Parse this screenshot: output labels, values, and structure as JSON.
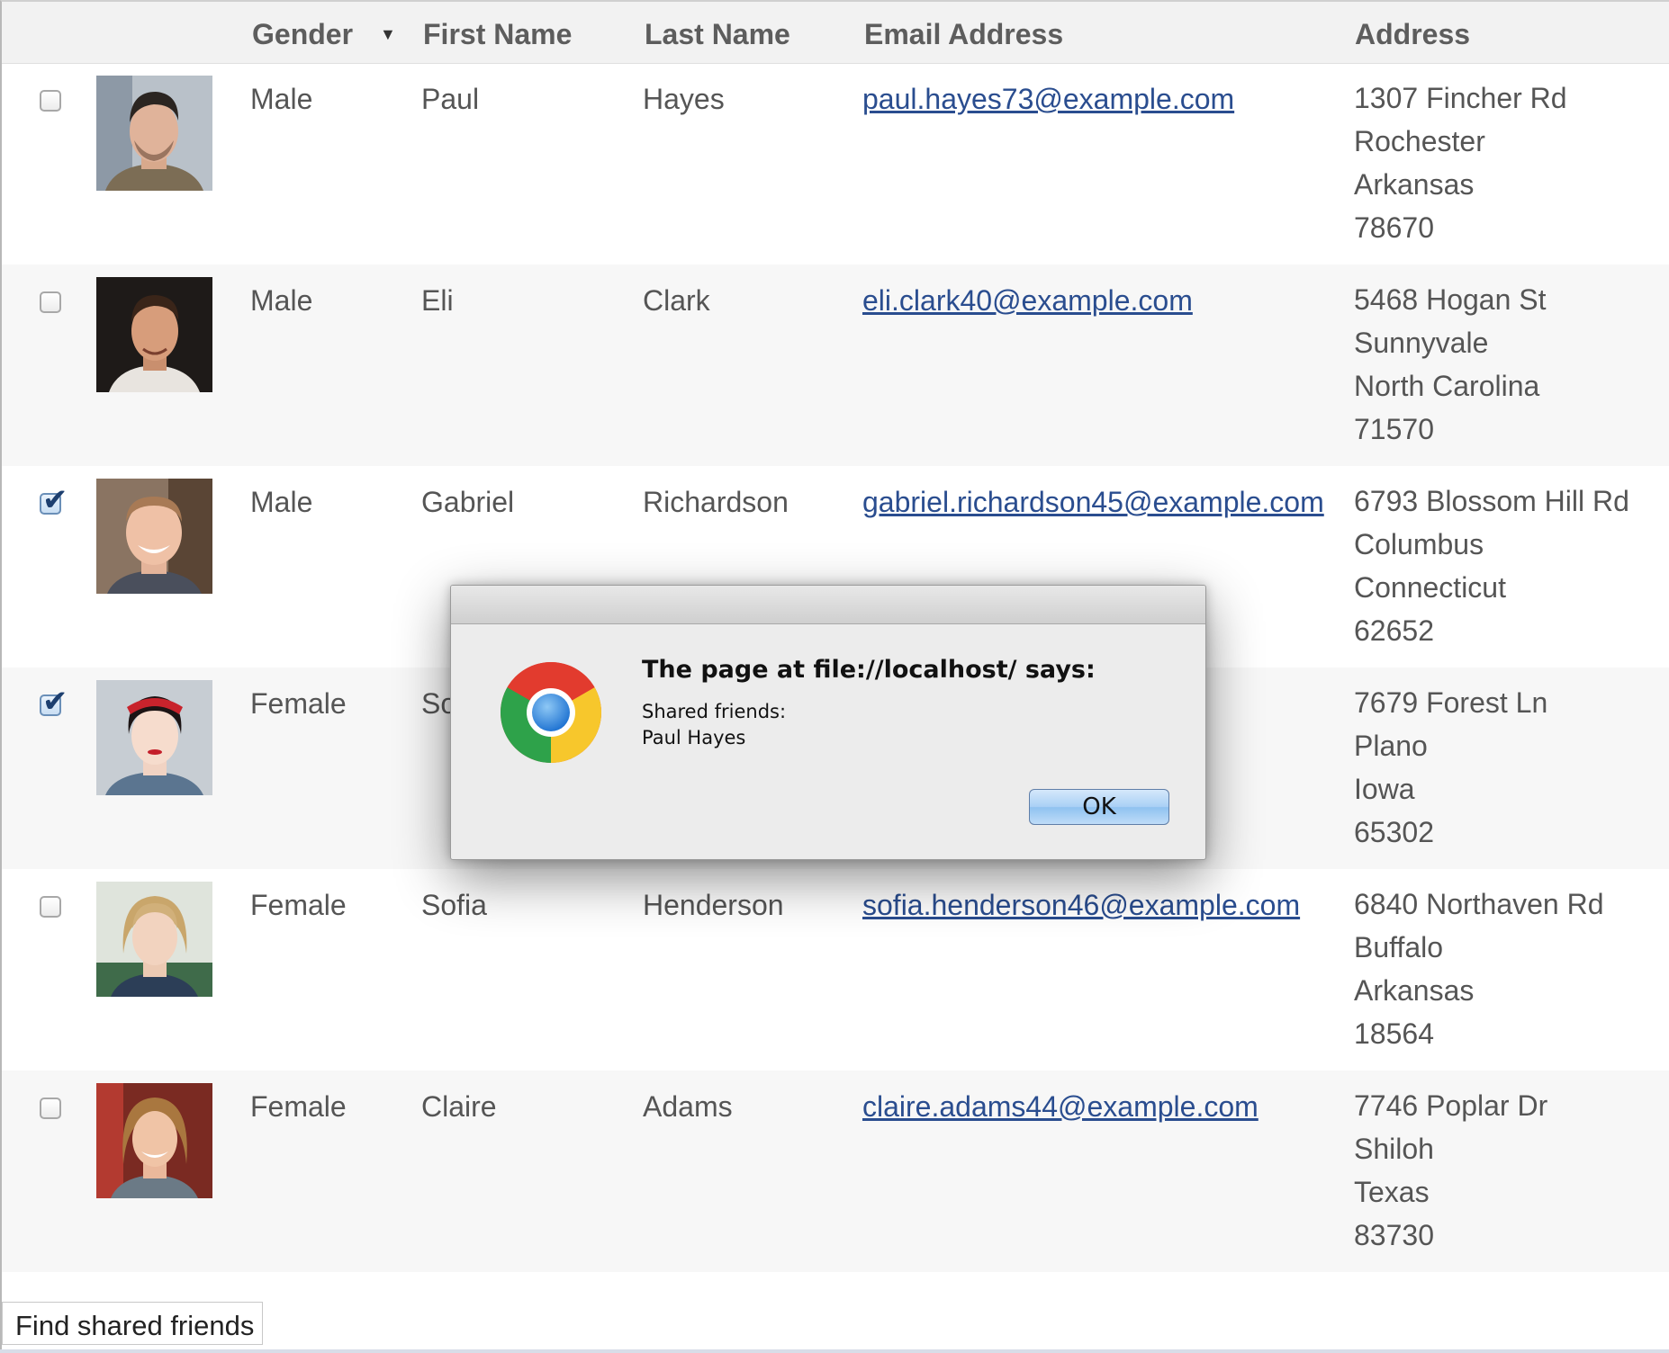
{
  "columns": {
    "gender": "Gender",
    "gender_sort_indicator": "▼",
    "first_name": "First Name",
    "last_name": "Last Name",
    "email": "Email Address",
    "address": "Address"
  },
  "rows": [
    {
      "checked": false,
      "gender": "Male",
      "first": "Paul",
      "last": "Hayes",
      "email": "paul.hayes73@example.com",
      "addr1": "1307 Fincher Rd",
      "addr2": "Rochester",
      "addr3": "Arkansas",
      "addr4": "78670"
    },
    {
      "checked": false,
      "gender": "Male",
      "first": "Eli",
      "last": "Clark",
      "email": "eli.clark40@example.com",
      "addr1": "5468 Hogan St",
      "addr2": "Sunnyvale",
      "addr3": "North Carolina",
      "addr4": "71570"
    },
    {
      "checked": true,
      "gender": "Male",
      "first": "Gabriel",
      "last": "Richardson",
      "email": "gabriel.richardson45@example.com",
      "addr1": "6793 Blossom Hill Rd",
      "addr2": "Columbus",
      "addr3": "Connecticut",
      "addr4": "62652"
    },
    {
      "checked": true,
      "gender": "Female",
      "first": "So",
      "last": "",
      "email": "",
      "addr1": "7679 Forest Ln",
      "addr2": "Plano",
      "addr3": "Iowa",
      "addr4": "65302"
    },
    {
      "checked": false,
      "gender": "Female",
      "first": "Sofia",
      "last": "Henderson",
      "email": "sofia.henderson46@example.com",
      "addr1": "6840 Northaven Rd",
      "addr2": "Buffalo",
      "addr3": "Arkansas",
      "addr4": "18564"
    },
    {
      "checked": false,
      "gender": "Female",
      "first": "Claire",
      "last": "Adams",
      "email": "claire.adams44@example.com",
      "addr1": "7746 Poplar Dr",
      "addr2": "Shiloh",
      "addr3": "Texas",
      "addr4": "83730"
    }
  ],
  "find_button_label": "Find shared friends",
  "checkbox_tick": "✔",
  "dialog": {
    "title": "The page at file://localhost/ says:",
    "message_line1": "Shared friends:",
    "message_line2": "Paul Hayes",
    "ok_label": "OK"
  },
  "colors": {
    "link": "#2a4d8f",
    "header_bg": "#f2f2f2",
    "alt_row_bg": "#f7f7f7",
    "ok_button": "#a9d0f5"
  }
}
